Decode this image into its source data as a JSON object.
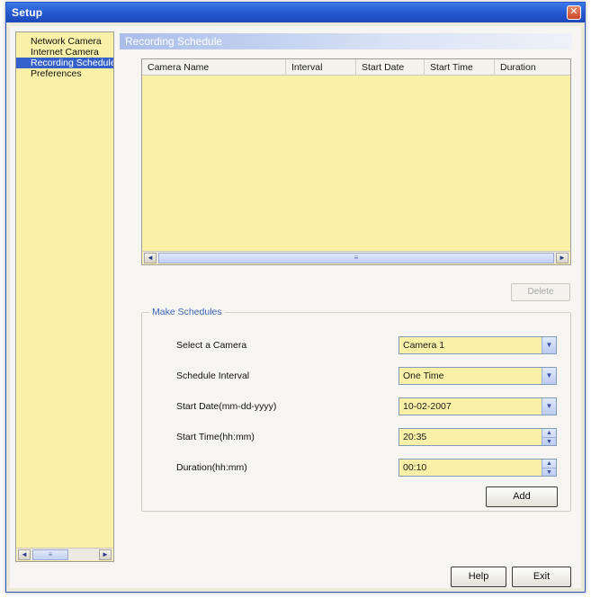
{
  "window": {
    "title": "Setup",
    "close_glyph": "✕"
  },
  "sidebar": {
    "items": [
      {
        "label": "Network Camera"
      },
      {
        "label": "Internet Camera"
      },
      {
        "label": "Recording Schedule",
        "selected": true
      },
      {
        "label": "Preferences"
      }
    ],
    "scroll_left": "◄",
    "scroll_right": "►",
    "scroll_thumb": "≡"
  },
  "panel": {
    "title": "Recording Schedule",
    "table": {
      "columns": [
        "Camera Name",
        "Interval",
        "Start Date",
        "Start Time",
        "Duration"
      ],
      "rows": []
    },
    "scroll_left": "◄",
    "scroll_right": "►",
    "scroll_thumb": "≡",
    "delete_label": "Delete"
  },
  "make_schedules": {
    "title": "Make Schedules",
    "camera": {
      "label": "Select a Camera",
      "value": "Camera 1"
    },
    "interval": {
      "label": "Schedule Interval",
      "value": "One Time"
    },
    "start_date": {
      "label": "Start Date(mm-dd-yyyy)",
      "value": "10-02-2007"
    },
    "start_time": {
      "label": "Start Time(hh:mm)",
      "value": "20:35"
    },
    "duration": {
      "label": "Duration(hh:mm)",
      "value": "00:10"
    },
    "dropdown_glyph": "▼",
    "spin_up": "▲",
    "spin_down": "▼",
    "add_label": "Add"
  },
  "footer": {
    "help_label": "Help",
    "exit_label": "Exit"
  },
  "colors": {
    "titlebar": "#2457d0",
    "field_bg": "#fbf0a8",
    "selection": "#3461c9",
    "accent_text": "#3d63b9"
  }
}
